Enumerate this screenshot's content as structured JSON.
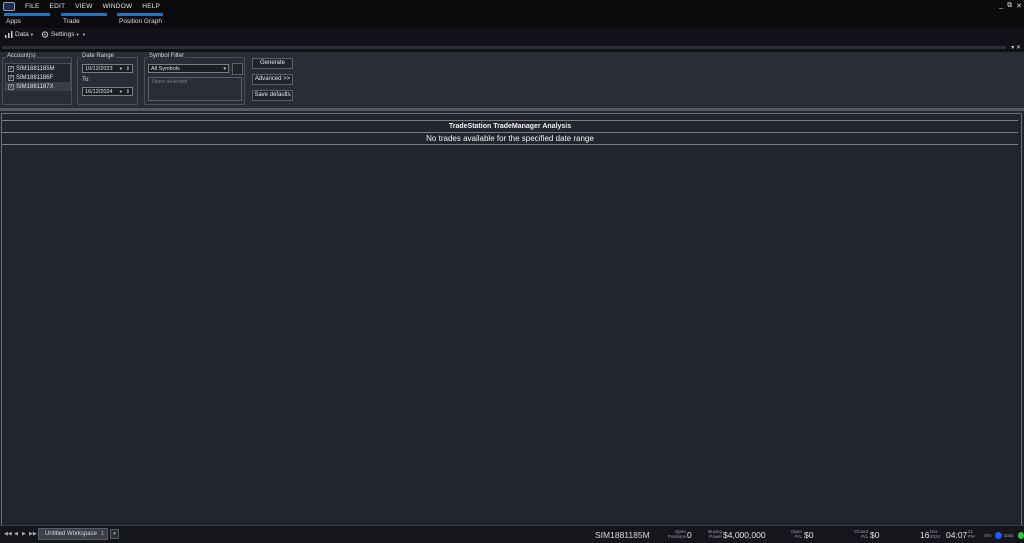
{
  "menu": {
    "items": [
      "FILE",
      "EDIT",
      "VIEW",
      "WINDOW",
      "HELP"
    ],
    "window_controls": [
      "_",
      "⧉",
      "✕"
    ]
  },
  "app_tabs": [
    "Apps",
    "Trade",
    "Position Graph"
  ],
  "toolbar": {
    "data_label": "Data",
    "settings_label": "Settings"
  },
  "accounts": {
    "title": "Account(s)",
    "items": [
      {
        "label": "SIM1881185M",
        "checked": true
      },
      {
        "label": "SIM1881186F",
        "checked": true
      },
      {
        "label": "SIM1881187X",
        "checked": true
      }
    ]
  },
  "date_range": {
    "title": "Date Range",
    "from": "10/12/2023",
    "to_label": "To:",
    "to": "16/12/2024"
  },
  "symbol_filter": {
    "title": "Symbol Filter",
    "selected": "All Symbols",
    "placeholder": "None selected"
  },
  "buttons": {
    "generate": "Generate",
    "advanced": "Advanced >>",
    "save_defaults": "Save defaults"
  },
  "report": {
    "title": "TradeStation TradeManager Analysis",
    "message": "No trades available for the specified date range"
  },
  "statusbar": {
    "workspace_tab": "Untitled Workspace",
    "workspace_count": "1",
    "account": "SIM1881185M",
    "open_positions_label": [
      "Open",
      "Positions"
    ],
    "open_positions": "0",
    "buying_power_label": [
      "Buying",
      "Power"
    ],
    "buying_power": "$4,000,000",
    "open_pl_label": [
      "Open",
      "P/L"
    ],
    "open_pl": "$0",
    "closed_pl_label": [
      "Closed",
      "P/L"
    ],
    "closed_pl": "$0",
    "day": "16",
    "month_year": [
      "Dec",
      "2024"
    ],
    "time": "04:07",
    "seconds_ampm": [
      "21",
      "PM"
    ],
    "sim_label": "Sim",
    "data_label": "Data",
    "colors": {
      "sim_dot": "#1a5cff",
      "data_dot": "#2ecc40",
      "accent": "#1478c8"
    }
  }
}
